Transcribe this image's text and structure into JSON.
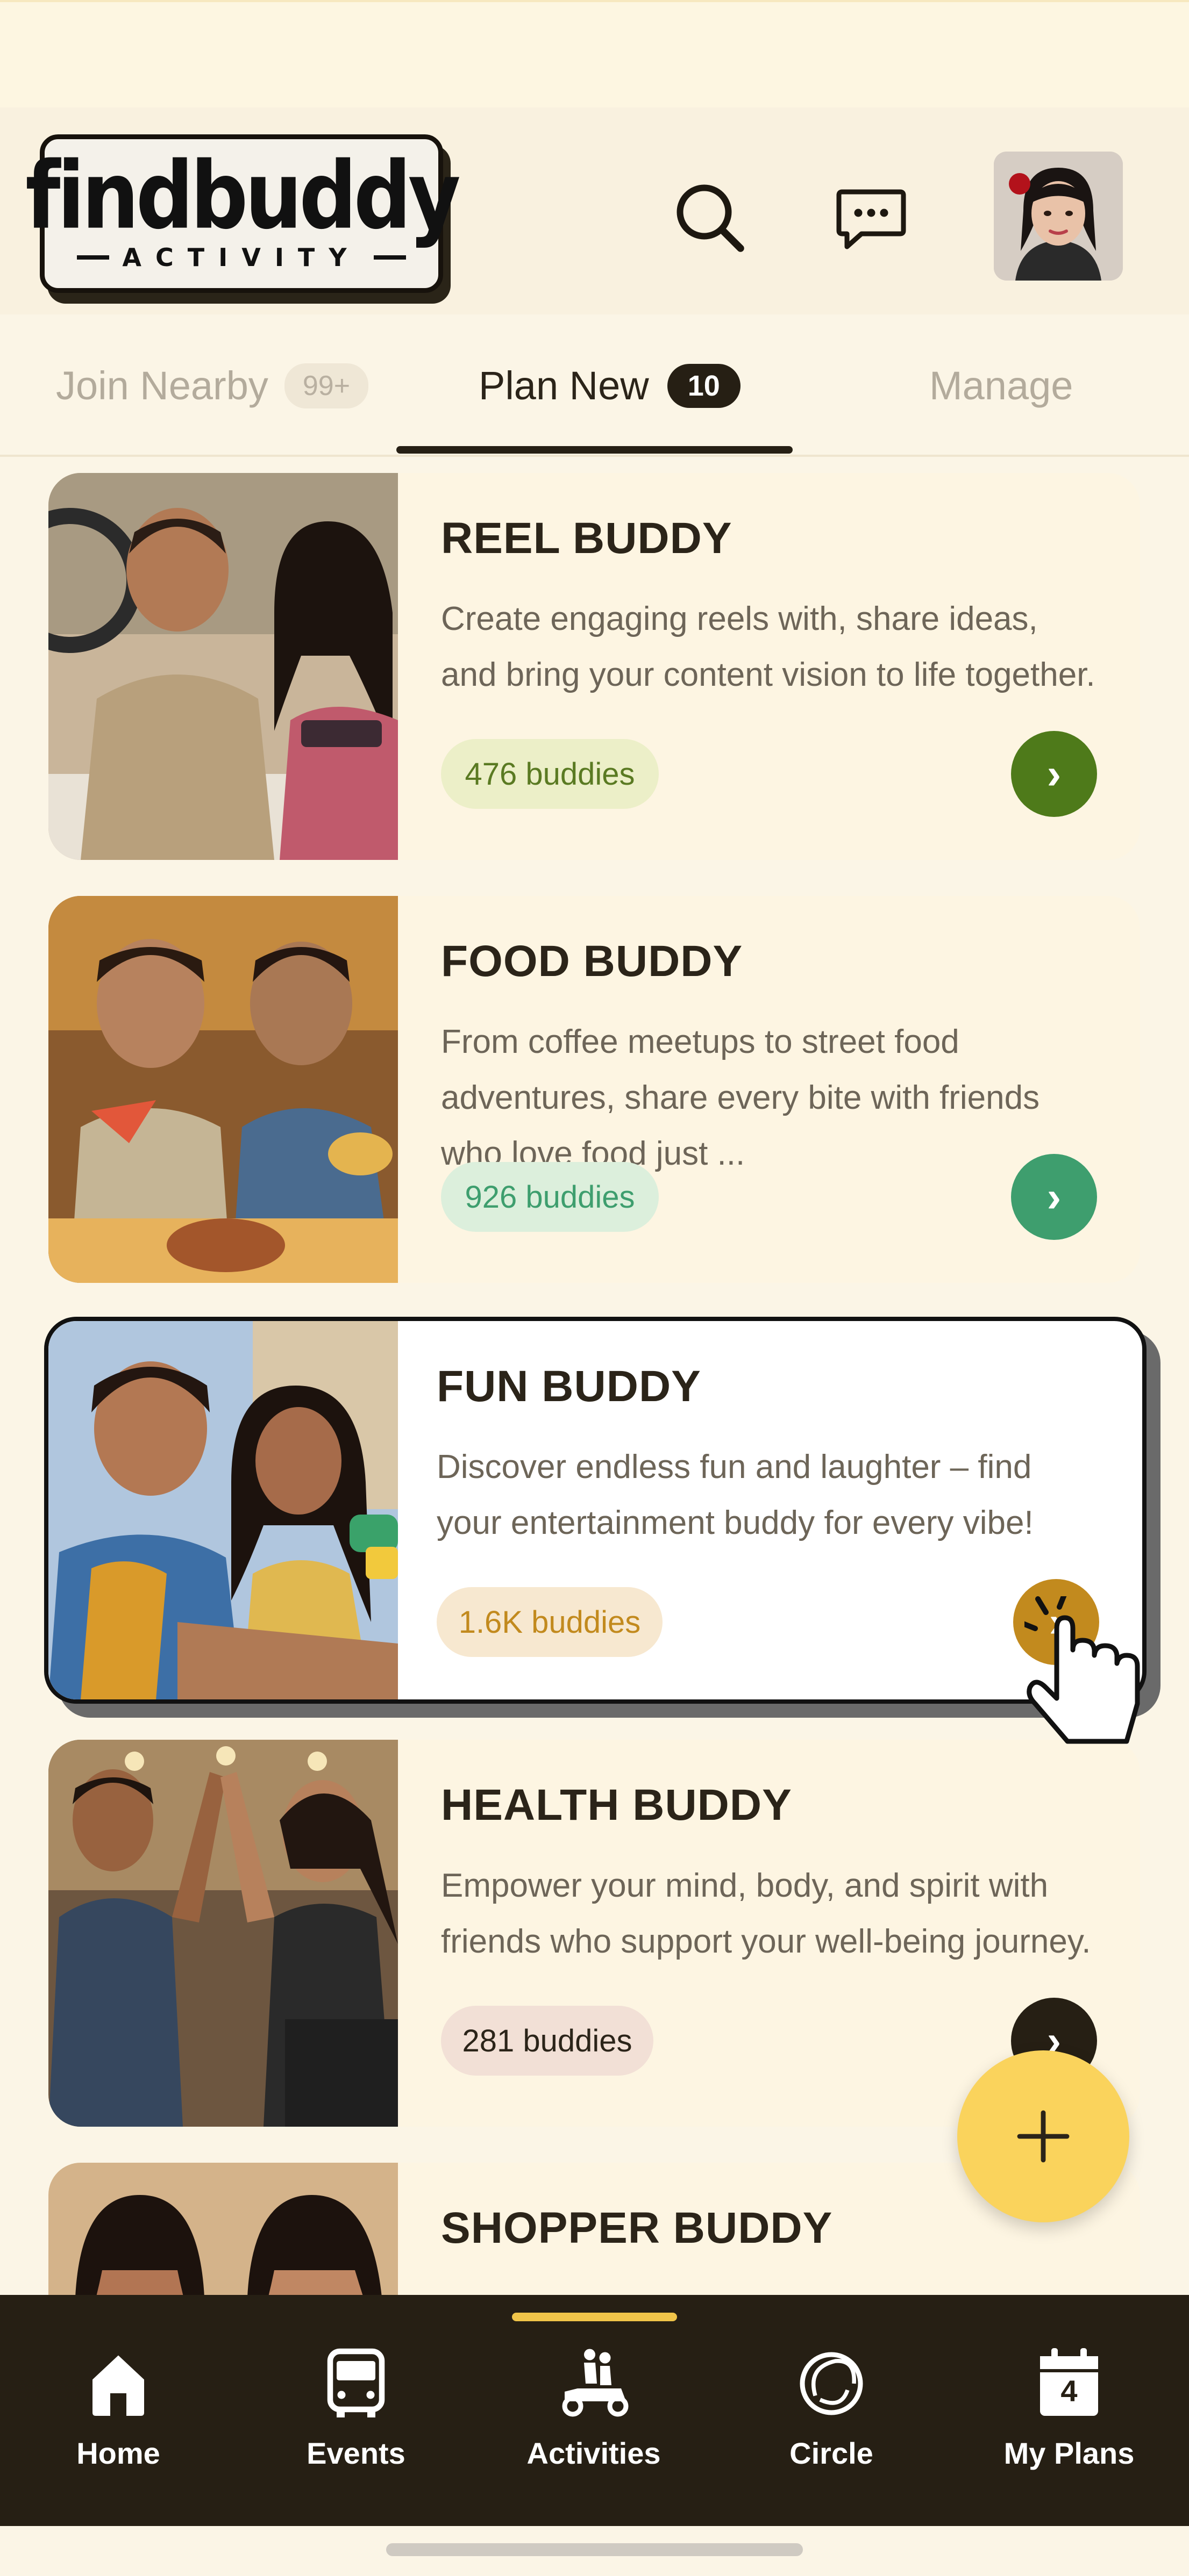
{
  "app": {
    "logo_title": "findbuddy",
    "logo_subtitle": "ACTIVITY"
  },
  "header": {
    "search_icon": "search-icon",
    "chat_icon": "chat-bubble-icon",
    "avatar": "user-avatar"
  },
  "tabs": [
    {
      "label": "Join Nearby",
      "badge": "99+"
    },
    {
      "label": "Plan New",
      "badge": "10"
    },
    {
      "label": "Manage"
    }
  ],
  "cards": [
    {
      "title": "REEL BUDDY",
      "description": "Create engaging reels with, share ideas, and bring your content vision to life together.",
      "count": "476 buddies"
    },
    {
      "title": "FOOD BUDDY",
      "description": "From coffee meetups to street food adventures, share every bite with friends who love food just ...",
      "count": "926 buddies"
    },
    {
      "title": "FUN BUDDY",
      "description": "Discover endless fun and laughter – find your entertainment buddy for every vibe!",
      "count": "1.6K buddies"
    },
    {
      "title": "HEALTH BUDDY",
      "description": "Empower your mind, body, and spirit with friends who support your well-being journey.",
      "count": "281 buddies"
    },
    {
      "title": "SHOPPER BUDDY",
      "description": "",
      "count": ""
    }
  ],
  "fab": {
    "icon": "plus-icon"
  },
  "nav": [
    {
      "label": "Home",
      "icon": "home-icon"
    },
    {
      "label": "Events",
      "icon": "bus-icon"
    },
    {
      "label": "Activities",
      "icon": "scooter-icon"
    },
    {
      "label": "Circle",
      "icon": "circle-swirl-icon"
    },
    {
      "label": "My Plans",
      "icon": "calendar-icon",
      "date": "4"
    }
  ],
  "colors": {
    "reel": "#4e7a1a",
    "food": "#3e9e6e",
    "fun": "#c28a1e",
    "health": "#261f14",
    "fab": "#fad35c",
    "nav_bg": "#261f14"
  }
}
